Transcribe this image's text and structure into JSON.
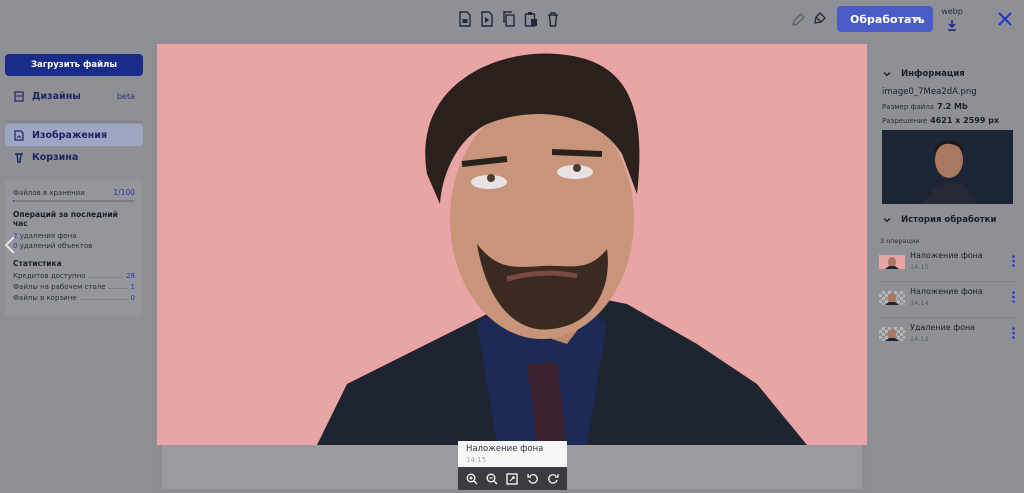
{
  "toolbar": {
    "icons": [
      "save-image-icon",
      "forward-icon",
      "copy-icon",
      "paste-icon",
      "delete-icon",
      "edit-icon",
      "magic-eraser-icon"
    ],
    "process_label": "Обработать",
    "format_label": "webp",
    "accent_color": "#4a5bc7"
  },
  "sidebar": {
    "upload_label": "Загрузить файлы",
    "items": [
      {
        "label": "Дизайны",
        "badge": "beta",
        "icon": "layers-icon"
      },
      {
        "label": "Изображения",
        "icon": "image-file-icon"
      },
      {
        "label": "Корзина",
        "icon": "trash-icon"
      }
    ],
    "storage": {
      "label": "Файлов в хранении",
      "value": "1/100",
      "fill_fraction": 0.01
    },
    "last_hour": {
      "title": "Операций за последний час",
      "bg_removals_count": "2",
      "bg_removals_label": "удаления фона",
      "obj_removals_count": "0",
      "obj_removals_label": "удалений объектов"
    },
    "stats": {
      "title": "Статистика",
      "rows": [
        {
          "label": "Кредитов доступно",
          "value": "28"
        },
        {
          "label": "Файлы на рабочем столе",
          "value": "1"
        },
        {
          "label": "Файлы в корзине",
          "value": "0"
        }
      ]
    }
  },
  "tooltip": {
    "title": "Наложение фона",
    "time": "14:15"
  },
  "zoom_controls": [
    "zoom-in-icon",
    "zoom-out-icon",
    "fit-screen-icon",
    "rotate-left-icon",
    "rotate-right-icon"
  ],
  "info": {
    "section_title": "Информация",
    "filename": "image0_7Mea2dA.png",
    "size_label": "Размер файла",
    "size_value": "7.2 Mb",
    "resolution_label": "Разрешение",
    "resolution_value": "4621 x 2599 px"
  },
  "history": {
    "section_title": "История обработки",
    "count_label": "3 операции",
    "items": [
      {
        "name": "Наложение фона",
        "time": "14:15"
      },
      {
        "name": "Наложение фона",
        "time": "14:14"
      },
      {
        "name": "Удаление фона",
        "time": "14:12"
      }
    ]
  },
  "image_bg_color": "#e9a5a5"
}
